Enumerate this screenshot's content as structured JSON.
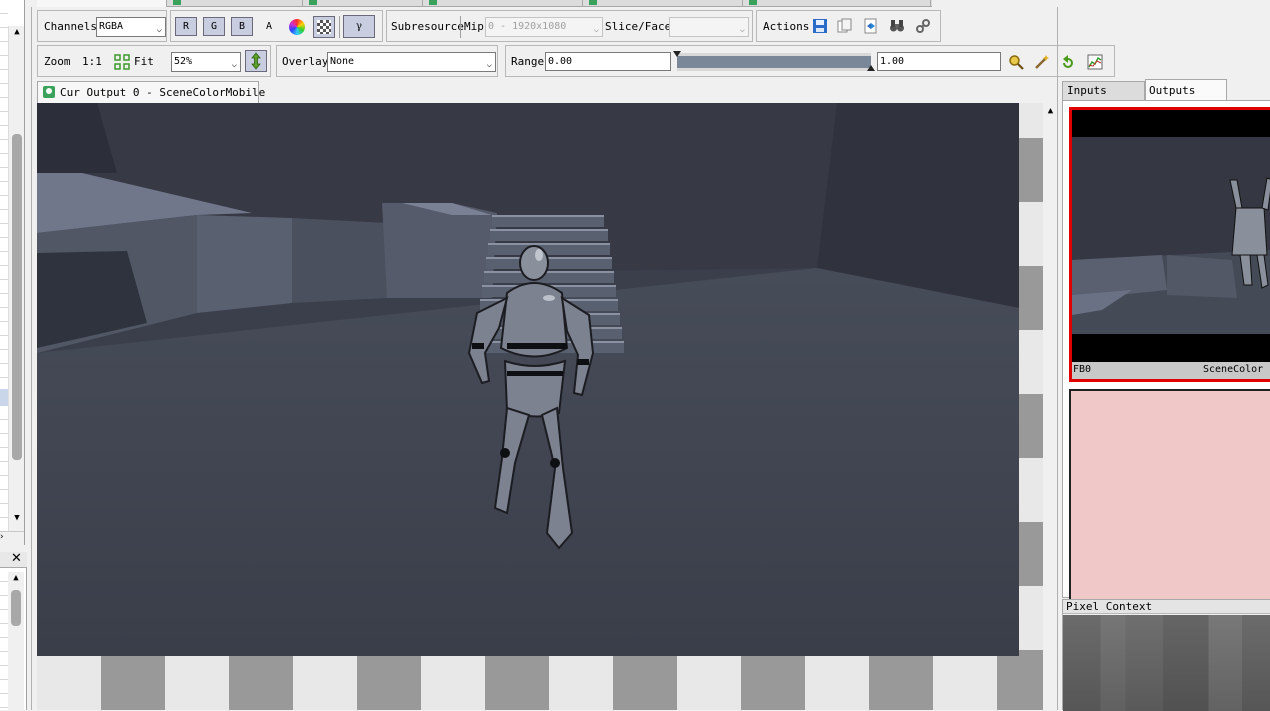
{
  "toolbar": {
    "channels_label": "Channels",
    "channels_value": "RGBA",
    "r_label": "R",
    "g_label": "G",
    "b_label": "B",
    "a_label": "A",
    "gamma_label": "γ",
    "subresource_label": "Subresource",
    "mip_label": "Mip",
    "mip_value": "0 - 1920x1080",
    "slice_label": "Slice/Face",
    "slice_value": "",
    "actions_label": "Actions"
  },
  "toolbar2": {
    "zoom_label": "Zoom",
    "zoom_ratio": "1:1",
    "fit_label": "Fit",
    "zoom_value": "52%",
    "overlay_label": "Overlay",
    "overlay_value": "None",
    "range_label": "Range",
    "range_min": "0.00",
    "range_max": "1.00",
    "range_fill_start": 0,
    "range_fill_end": 1
  },
  "viewer": {
    "tab_title": "Cur Output 0 - SceneColorMobile"
  },
  "right_panel": {
    "tabs": [
      "Inputs",
      "Outputs"
    ],
    "active_tab": "Outputs",
    "thumb_label": "FB0",
    "thumb_name": "SceneColor",
    "pixel_context_label": "Pixel Context"
  },
  "colors": {
    "scene_dark": "#3b3f4b",
    "thumb_selected_border": "#e00000",
    "empty_thumb": "#f0c8c8",
    "checker_dark": "#999999",
    "checker_light": "#e8e8e8"
  }
}
